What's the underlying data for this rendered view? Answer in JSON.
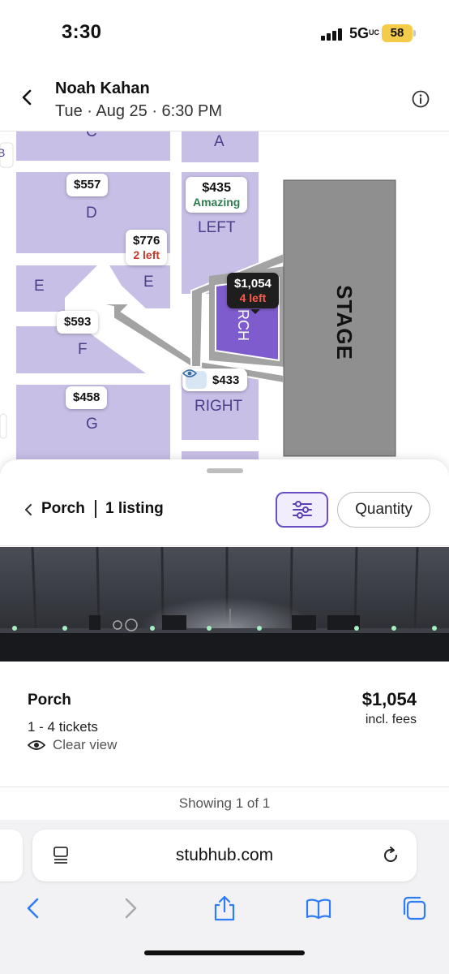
{
  "status_bar": {
    "time": "3:30",
    "network": "5G",
    "network_suffix": "UC",
    "battery": "58"
  },
  "header": {
    "title": "Noah Kahan",
    "subtitle": "Tue · Aug 25 · 6:30 PM"
  },
  "map": {
    "stage_label": "STAGE",
    "sections": {
      "c": "C",
      "a": "A",
      "d": "D",
      "left": "LEFT",
      "e_left": "E",
      "e_right": "E",
      "f": "F",
      "g": "G",
      "right": "RIGHT",
      "porch": "RCH",
      "edge_b": "B"
    },
    "pins": {
      "d": {
        "price": "$557"
      },
      "left": {
        "price": "$435",
        "note": "Amazing"
      },
      "e": {
        "price": "$776",
        "note": "2 left"
      },
      "porch": {
        "price": "$1,054",
        "note": "4 left"
      },
      "f": {
        "price": "$593"
      },
      "g": {
        "price": "$458"
      },
      "right": {
        "price": "$433"
      }
    },
    "colors": {
      "section": "#c8bfe7",
      "selected_section": "#7e5ccd",
      "stage": "#8f8f8f",
      "walkway": "#a3a3a3"
    }
  },
  "sheet": {
    "section_name": "Porch",
    "listing_count": "1 listing",
    "quantity_label": "Quantity",
    "listing": {
      "section": "Porch",
      "quantity": "1 - 4 tickets",
      "view_label": "Clear view",
      "price": "$1,054",
      "fees": "incl. fees"
    },
    "showing": "Showing 1 of 1"
  },
  "browser": {
    "url": "stubhub.com"
  }
}
